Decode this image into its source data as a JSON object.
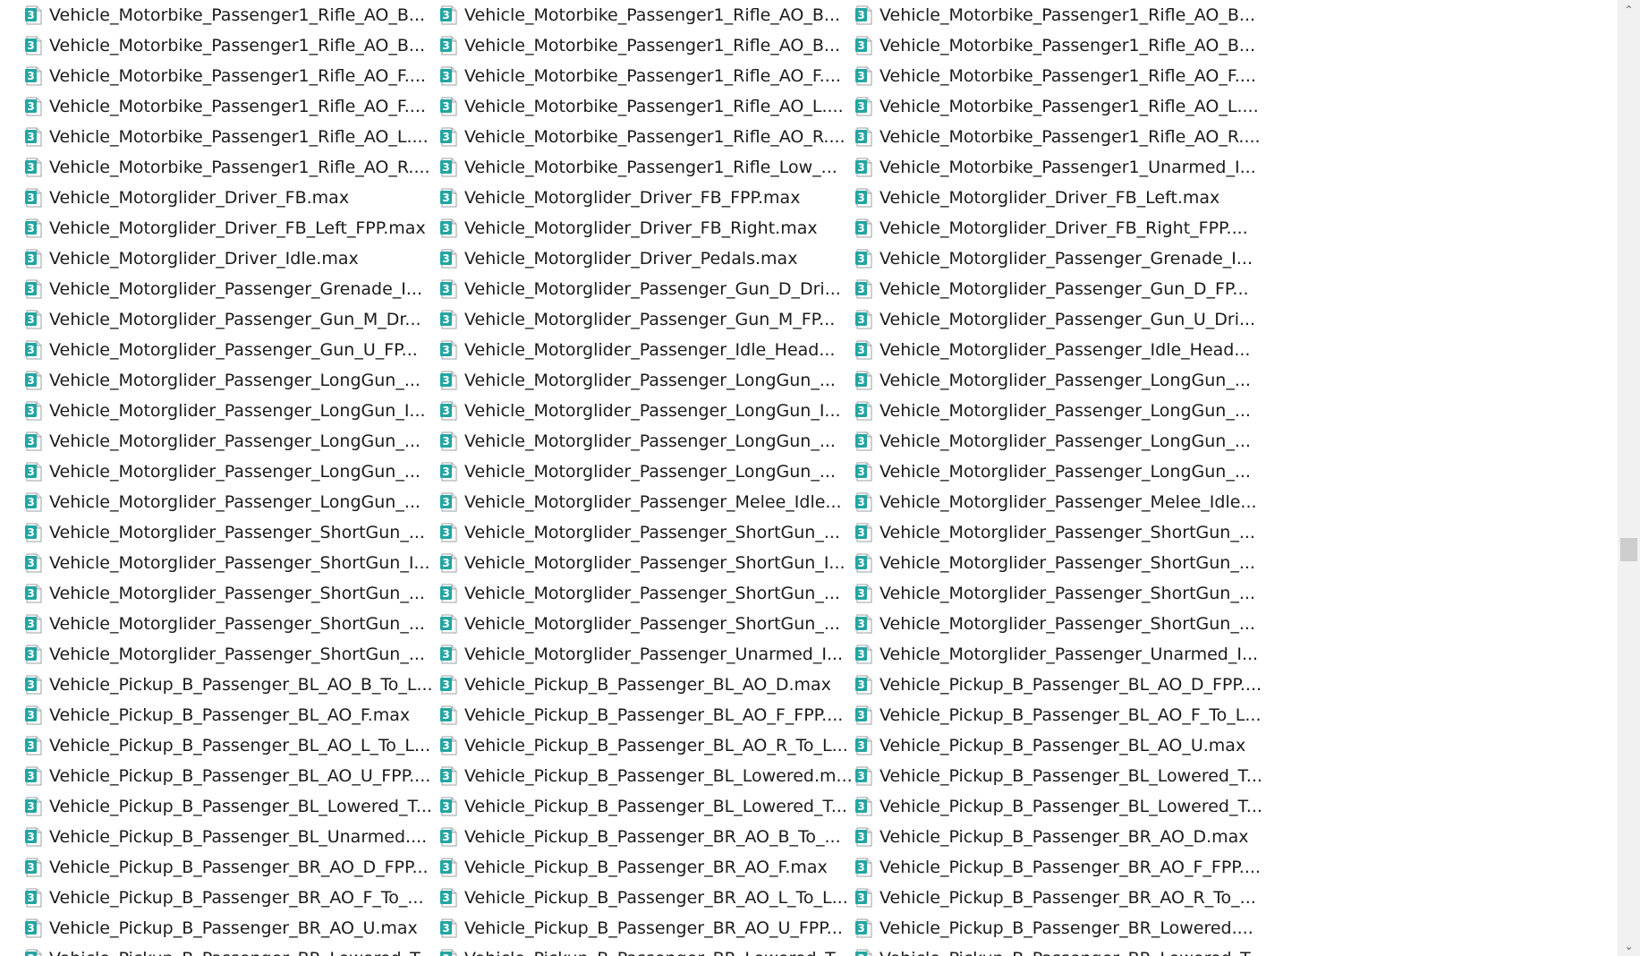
{
  "icon": {
    "name": "3dsmax-file-icon",
    "color": "#24a5a1",
    "glyph": "3"
  },
  "scrollbar": {
    "up_glyph": "⌃",
    "down_glyph": "⌄",
    "position": 0.58,
    "thumb_fraction": 0.025
  },
  "files": [
    "Vehicle_Motorbike_Passenger1_Rifle_AO_B...",
    "Vehicle_Motorbike_Passenger1_Rifle_AO_B...",
    "Vehicle_Motorbike_Passenger1_Rifle_AO_B...",
    "Vehicle_Motorbike_Passenger1_Rifle_AO_B...",
    "Vehicle_Motorbike_Passenger1_Rifle_AO_B...",
    "Vehicle_Motorbike_Passenger1_Rifle_AO_B...",
    "Vehicle_Motorbike_Passenger1_Rifle_AO_F....",
    "Vehicle_Motorbike_Passenger1_Rifle_AO_F....",
    "Vehicle_Motorbike_Passenger1_Rifle_AO_F....",
    "Vehicle_Motorbike_Passenger1_Rifle_AO_F....",
    "Vehicle_Motorbike_Passenger1_Rifle_AO_L....",
    "Vehicle_Motorbike_Passenger1_Rifle_AO_L....",
    "Vehicle_Motorbike_Passenger1_Rifle_AO_L....",
    "Vehicle_Motorbike_Passenger1_Rifle_AO_R....",
    "Vehicle_Motorbike_Passenger1_Rifle_AO_R....",
    "Vehicle_Motorbike_Passenger1_Rifle_AO_R....",
    "Vehicle_Motorbike_Passenger1_Rifle_Low_...",
    "Vehicle_Motorbike_Passenger1_Unarmed_I...",
    "Vehicle_Motorglider_Driver_FB.max",
    "Vehicle_Motorglider_Driver_FB_FPP.max",
    "Vehicle_Motorglider_Driver_FB_Left.max",
    "Vehicle_Motorglider_Driver_FB_Left_FPP.max",
    "Vehicle_Motorglider_Driver_FB_Right.max",
    "Vehicle_Motorglider_Driver_FB_Right_FPP....",
    "Vehicle_Motorglider_Driver_Idle.max",
    "Vehicle_Motorglider_Driver_Pedals.max",
    "Vehicle_Motorglider_Passenger_Grenade_I...",
    "Vehicle_Motorglider_Passenger_Grenade_I...",
    "Vehicle_Motorglider_Passenger_Gun_D_Dri...",
    "Vehicle_Motorglider_Passenger_Gun_D_FP...",
    "Vehicle_Motorglider_Passenger_Gun_M_Dr...",
    "Vehicle_Motorglider_Passenger_Gun_M_FP...",
    "Vehicle_Motorglider_Passenger_Gun_U_Dri...",
    "Vehicle_Motorglider_Passenger_Gun_U_FP...",
    "Vehicle_Motorglider_Passenger_Idle_Head...",
    "Vehicle_Motorglider_Passenger_Idle_Head...",
    "Vehicle_Motorglider_Passenger_LongGun_...",
    "Vehicle_Motorglider_Passenger_LongGun_...",
    "Vehicle_Motorglider_Passenger_LongGun_...",
    "Vehicle_Motorglider_Passenger_LongGun_I...",
    "Vehicle_Motorglider_Passenger_LongGun_I...",
    "Vehicle_Motorglider_Passenger_LongGun_...",
    "Vehicle_Motorglider_Passenger_LongGun_...",
    "Vehicle_Motorglider_Passenger_LongGun_...",
    "Vehicle_Motorglider_Passenger_LongGun_...",
    "Vehicle_Motorglider_Passenger_LongGun_...",
    "Vehicle_Motorglider_Passenger_LongGun_...",
    "Vehicle_Motorglider_Passenger_LongGun_...",
    "Vehicle_Motorglider_Passenger_LongGun_...",
    "Vehicle_Motorglider_Passenger_Melee_Idle...",
    "Vehicle_Motorglider_Passenger_Melee_Idle...",
    "Vehicle_Motorglider_Passenger_ShortGun_...",
    "Vehicle_Motorglider_Passenger_ShortGun_...",
    "Vehicle_Motorglider_Passenger_ShortGun_...",
    "Vehicle_Motorglider_Passenger_ShortGun_I...",
    "Vehicle_Motorglider_Passenger_ShortGun_I...",
    "Vehicle_Motorglider_Passenger_ShortGun_...",
    "Vehicle_Motorglider_Passenger_ShortGun_...",
    "Vehicle_Motorglider_Passenger_ShortGun_...",
    "Vehicle_Motorglider_Passenger_ShortGun_...",
    "Vehicle_Motorglider_Passenger_ShortGun_...",
    "Vehicle_Motorglider_Passenger_ShortGun_...",
    "Vehicle_Motorglider_Passenger_ShortGun_...",
    "Vehicle_Motorglider_Passenger_ShortGun_...",
    "Vehicle_Motorglider_Passenger_Unarmed_I...",
    "Vehicle_Motorglider_Passenger_Unarmed_I...",
    "Vehicle_Pickup_B_Passenger_BL_AO_B_To_L...",
    "Vehicle_Pickup_B_Passenger_BL_AO_D.max",
    "Vehicle_Pickup_B_Passenger_BL_AO_D_FPP....",
    "Vehicle_Pickup_B_Passenger_BL_AO_F.max",
    "Vehicle_Pickup_B_Passenger_BL_AO_F_FPP....",
    "Vehicle_Pickup_B_Passenger_BL_AO_F_To_L...",
    "Vehicle_Pickup_B_Passenger_BL_AO_L_To_L...",
    "Vehicle_Pickup_B_Passenger_BL_AO_R_To_L...",
    "Vehicle_Pickup_B_Passenger_BL_AO_U.max",
    "Vehicle_Pickup_B_Passenger_BL_AO_U_FPP....",
    "Vehicle_Pickup_B_Passenger_BL_Lowered.m...",
    "Vehicle_Pickup_B_Passenger_BL_Lowered_T...",
    "Vehicle_Pickup_B_Passenger_BL_Lowered_T...",
    "Vehicle_Pickup_B_Passenger_BL_Lowered_T...",
    "Vehicle_Pickup_B_Passenger_BL_Lowered_T...",
    "Vehicle_Pickup_B_Passenger_BL_Unarmed....",
    "Vehicle_Pickup_B_Passenger_BR_AO_B_To_...",
    "Vehicle_Pickup_B_Passenger_BR_AO_D.max",
    "Vehicle_Pickup_B_Passenger_BR_AO_D_FPP...",
    "Vehicle_Pickup_B_Passenger_BR_AO_F.max",
    "Vehicle_Pickup_B_Passenger_BR_AO_F_FPP....",
    "Vehicle_Pickup_B_Passenger_BR_AO_F_To_...",
    "Vehicle_Pickup_B_Passenger_BR_AO_L_To_L...",
    "Vehicle_Pickup_B_Passenger_BR_AO_R_To_...",
    "Vehicle_Pickup_B_Passenger_BR_AO_U.max",
    "Vehicle_Pickup_B_Passenger_BR_AO_U_FPP...",
    "Vehicle_Pickup_B_Passenger_BR_Lowered....",
    "Vehicle_Pickup_B_Passenger_BR_Lowered_T...",
    "Vehicle_Pickup_B_Passenger_BR_Lowered_T...",
    "Vehicle_Pickup_B_Passenger_BR_Lowered_T..."
  ]
}
